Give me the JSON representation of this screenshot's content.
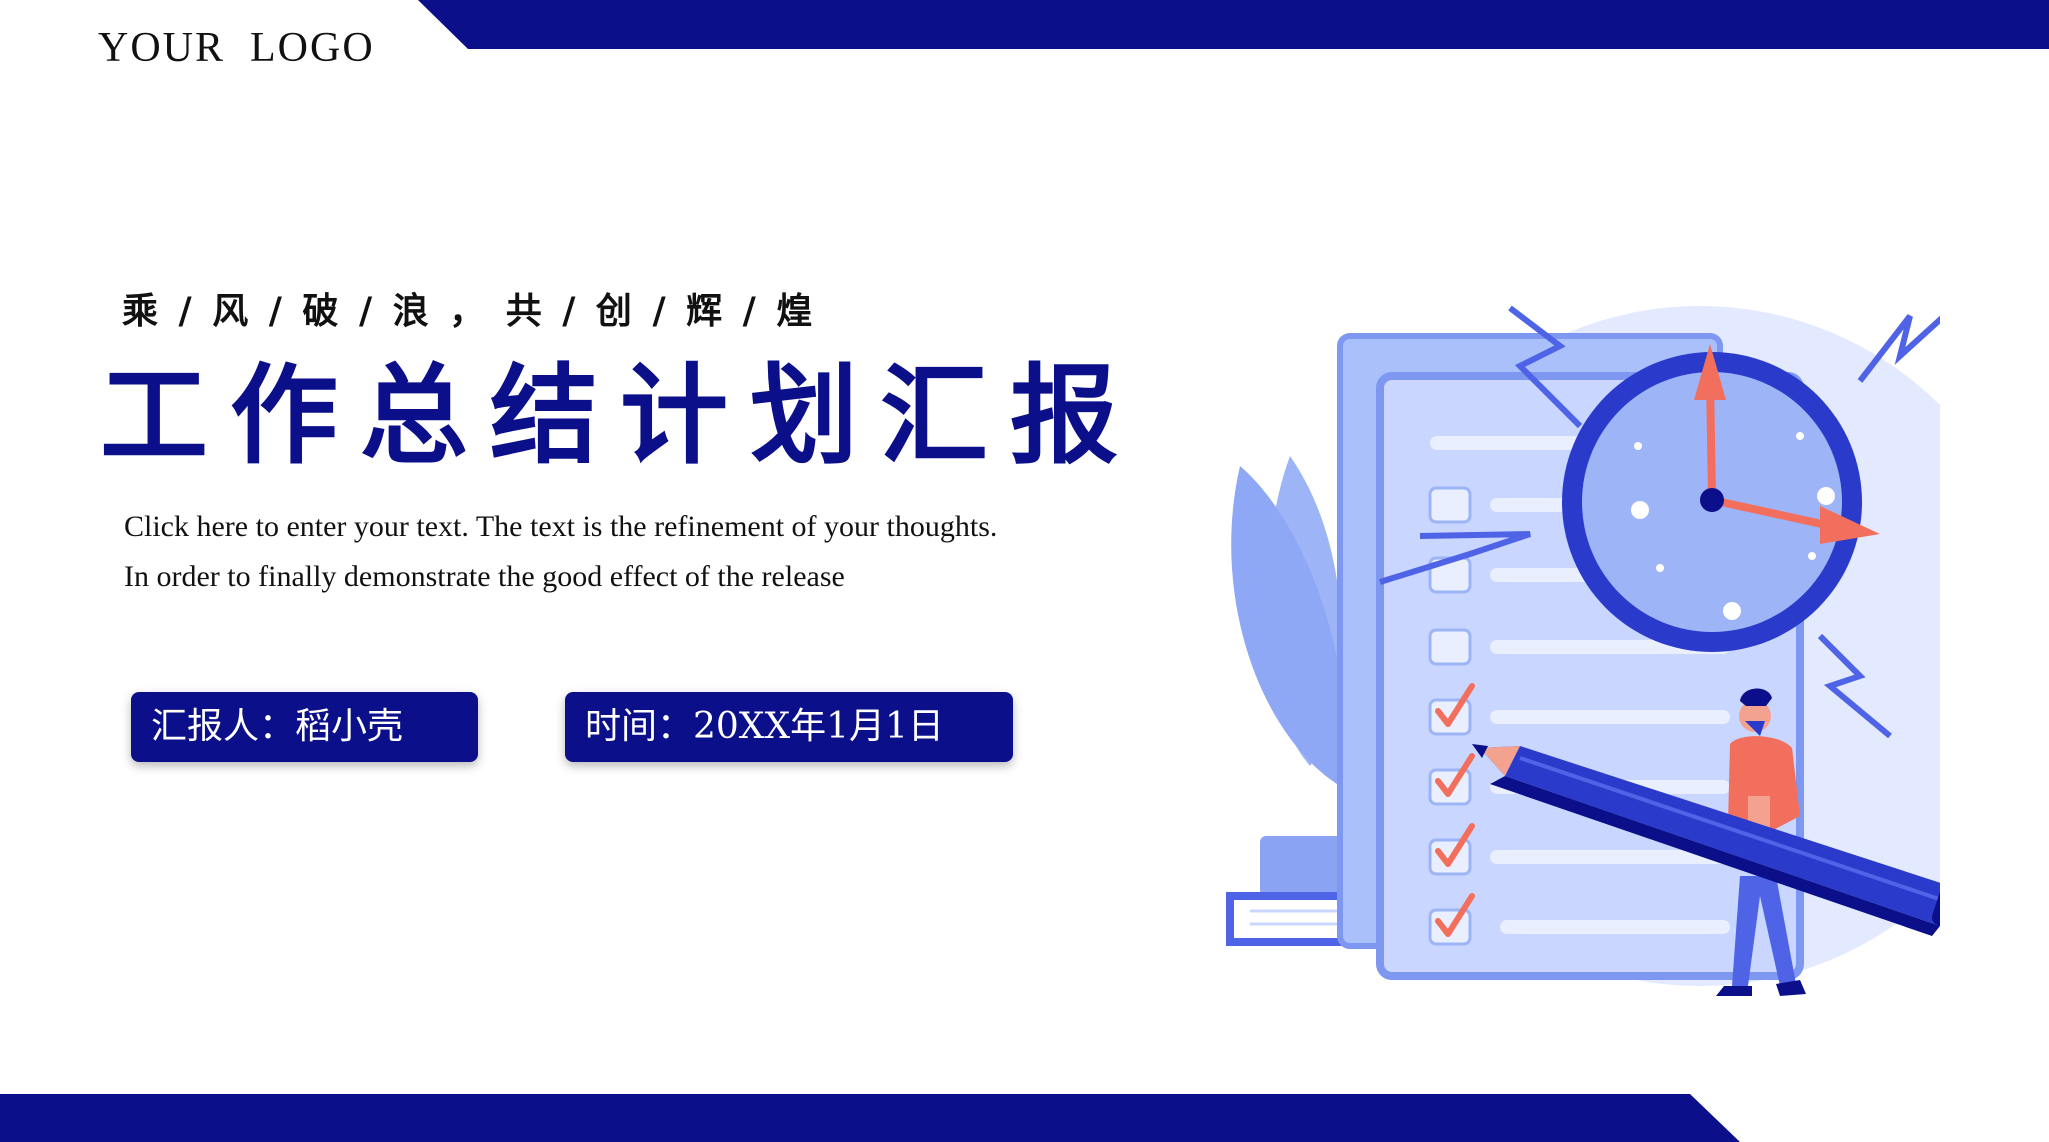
{
  "logo": {
    "text": "YOUR  LOGO"
  },
  "header": {
    "slogan": "乘 / 风 / 破 / 浪 ， 共 / 创 / 辉 / 煌",
    "title": "工作总结计划汇报"
  },
  "body": {
    "line1": "Click here to enter your text. The text is the refinement of your thoughts.",
    "line2": "In order to finally demonstrate the good effect of the release"
  },
  "info": {
    "reporter": "汇报人：稻小壳",
    "time": "时间：20XX年1月1日"
  },
  "colors": {
    "primary": "#0b0f8a",
    "accent_light": "#c9d6ff",
    "accent_mid": "#8fa8f5",
    "coral": "#f36f5d"
  },
  "illustration": {
    "icon": "checklist-clock-pencil-illustration"
  }
}
